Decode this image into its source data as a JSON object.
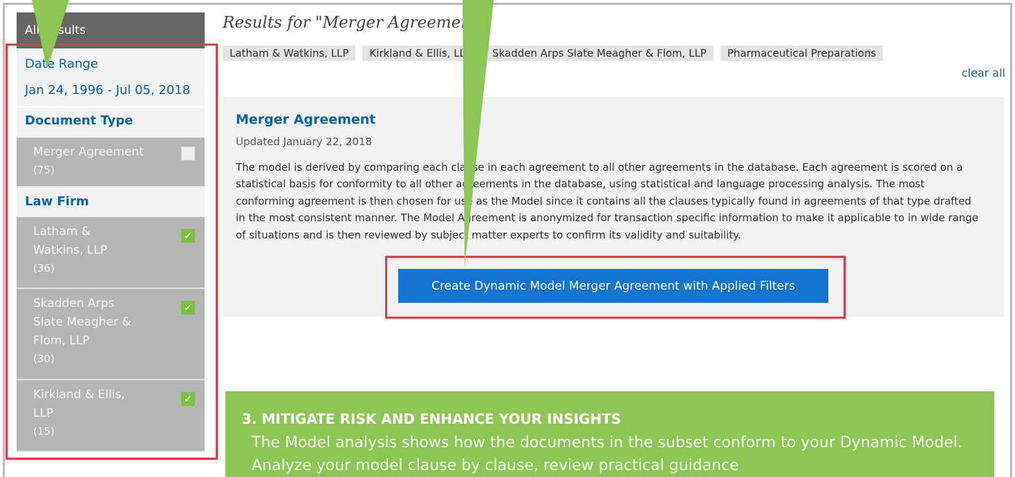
{
  "sidebar": {
    "header": "All Results",
    "date_range_label": "Date Range",
    "date_range_value": "Jan 24, 1996 - Jul 05, 2018",
    "document_type_label": "Document Type",
    "document_types": [
      {
        "label": "Merger Agreement",
        "count": "(75)",
        "checked": false
      }
    ],
    "law_firm_label": "Law Firm",
    "law_firms": [
      {
        "label": "Latham &\nWatkins, LLP",
        "count": "(36)",
        "checked": true
      },
      {
        "label": "Skadden Arps\nSlate Meagher &\nFlom, LLP",
        "count": "(30)",
        "checked": true
      },
      {
        "label": "Kirkland & Ellis,\nLLP",
        "count": "(15)",
        "checked": true
      }
    ]
  },
  "main": {
    "results_title": "Results for \"Merger Agreement\"",
    "filters": [
      "Latham & Watkins, LLP",
      "Kirkland & Ellis, LLP",
      "Skadden Arps Slate Meagher & Flom, LLP",
      "Pharmaceutical Preparations"
    ],
    "clear_all": "clear all",
    "card": {
      "title": "Merger Agreement",
      "updated": "Updated January 22, 2018",
      "description": "The model is derived by comparing each clause in each agreement to all other agreements in the database. Each agreement is scored on a statistical basis for conformity to all other agreements in the database, using statistical and language processing analysis. The most conforming agreement is then chosen for use as the Model since it contains all the clauses typically found in agreements of that type drafted in the most consistent manner. The Model Agreement is anonymized for transaction specific information to make it applicable to in wide range of situations and is then reviewed by subject matter experts to confirm its validity and suitability.",
      "button": "Create Dynamic Model Merger Agreement with Applied Filters"
    }
  },
  "callout": {
    "title": "3. MITIGATE RISK AND ENHANCE YOUR INSIGHTS",
    "body": "The Model analysis shows how the documents in the subset conform to your Dynamic Model. Analyze your model clause by clause, review practical guidance"
  },
  "colors": {
    "accent_blue": "#0a64a8",
    "button_blue": "#1474d2",
    "highlight_red": "#e53945",
    "callout_green": "#8dc655",
    "checkbox_green": "#7cc242"
  },
  "icons": {
    "checkbox_checked": "✓",
    "pointer": "green-arrow-icon"
  }
}
